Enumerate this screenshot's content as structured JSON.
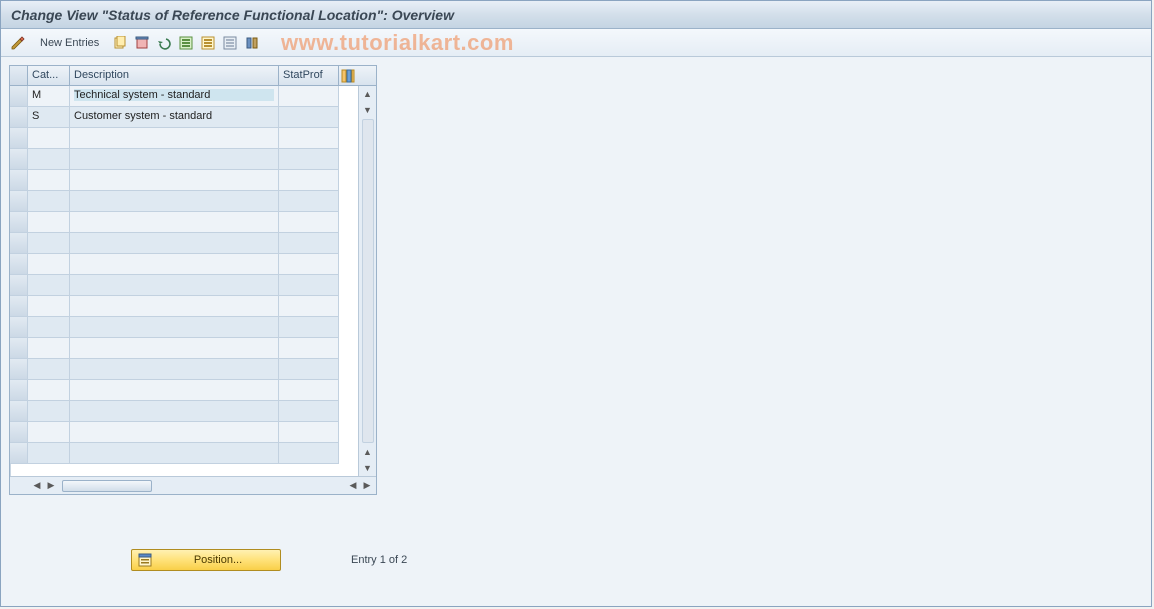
{
  "header": {
    "title": "Change View \"Status of Reference Functional Location\": Overview"
  },
  "toolbar": {
    "new_entries": "New Entries"
  },
  "watermark": "www.tutorialkart.com",
  "grid": {
    "columns": [
      "Cat...",
      "Description",
      "StatProf"
    ],
    "rows": [
      {
        "cat": "M",
        "desc": "Technical system - standard",
        "prof": ""
      },
      {
        "cat": "S",
        "desc": "Customer system - standard",
        "prof": ""
      }
    ]
  },
  "footer": {
    "position_label": "Position...",
    "entry_text": "Entry 1 of 2"
  }
}
